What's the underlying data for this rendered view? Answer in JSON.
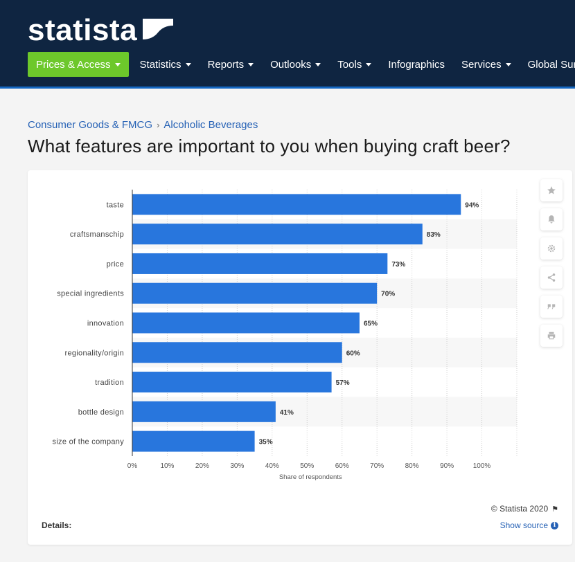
{
  "logo": {
    "text": "statista"
  },
  "nav": {
    "items": [
      {
        "label": "Prices & Access",
        "active": true,
        "caret": true
      },
      {
        "label": "Statistics",
        "caret": true
      },
      {
        "label": "Reports",
        "caret": true
      },
      {
        "label": "Outlooks",
        "caret": true
      },
      {
        "label": "Tools",
        "caret": true
      },
      {
        "label": "Infographics",
        "caret": false
      },
      {
        "label": "Services",
        "caret": true
      },
      {
        "label": "Global Sur",
        "caret": false
      }
    ]
  },
  "breadcrumb": {
    "first": "Consumer Goods & FMCG",
    "separator": "›",
    "second": "Alcoholic Beverages"
  },
  "page": {
    "title": "What features are important to you when buying craft beer?"
  },
  "chart_data": {
    "type": "bar",
    "orientation": "horizontal",
    "categories": [
      "taste",
      "craftsmanschip",
      "price",
      "special ingredients",
      "innovation",
      "regionality/origin",
      "tradition",
      "bottle design",
      "size of the company"
    ],
    "values": [
      94,
      83,
      73,
      70,
      65,
      60,
      57,
      41,
      35
    ],
    "value_labels": [
      "94%",
      "83%",
      "73%",
      "70%",
      "65%",
      "60%",
      "57%",
      "41%",
      "35%"
    ],
    "xlabel": "Share of respondents",
    "xlim": [
      0,
      110
    ],
    "xticks": [
      0,
      10,
      20,
      30,
      40,
      50,
      60,
      70,
      80,
      90,
      100
    ],
    "xtick_labels": [
      "0%",
      "10%",
      "20%",
      "30%",
      "40%",
      "50%",
      "60%",
      "70%",
      "80%",
      "90%",
      "100%"
    ],
    "grid": true,
    "bar_color": "#2876dd"
  },
  "tools": [
    "star-icon",
    "bell-icon",
    "gear-icon",
    "share-icon",
    "quote-icon",
    "print-icon"
  ],
  "footer": {
    "copyright": "© Statista 2020",
    "details_label": "Details:",
    "source_label": "Show source"
  },
  "colors": {
    "header_bg": "#0f2541",
    "accent_green": "#6dc82b",
    "link_blue": "#2561b5"
  }
}
